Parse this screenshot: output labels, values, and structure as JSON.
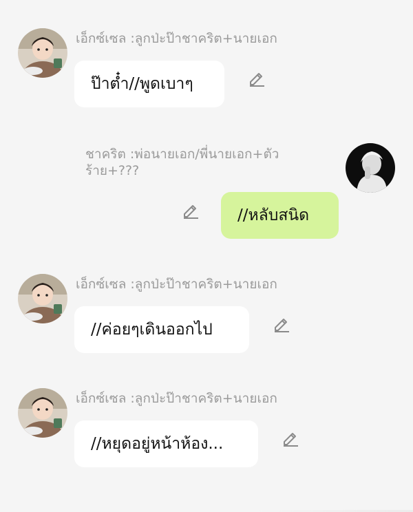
{
  "messages": [
    {
      "side": "left",
      "sender": "เอ็กซ์เซล :ลูกป่ะป๊าชาคริต+นายเอก",
      "text": "ป๊าต๋ำ//พูดเบาๆ",
      "avatar_icon": "baby-avatar-icon",
      "edit_icon": "pencil-icon"
    },
    {
      "side": "right",
      "sender": "ชาคริต :พ่อนายเอก/พี่นายเอก+ตัวร้าย+???",
      "text": "//หลับสนิด",
      "avatar_icon": "man-avatar-icon",
      "edit_icon": "pencil-icon"
    },
    {
      "side": "left",
      "sender": "เอ็กซ์เซล :ลูกป่ะป๊าชาคริต+นายเอก",
      "text": "//ค่อยๆเดินออกไป",
      "avatar_icon": "baby-avatar-icon",
      "edit_icon": "pencil-icon"
    },
    {
      "side": "left",
      "sender": "เอ็กซ์เซล :ลูกป่ะป๊าชาคริต+นายเอก",
      "text": "//หยุดอยู่หน้าห้อง...",
      "avatar_icon": "baby-avatar-icon",
      "edit_icon": "pencil-icon"
    }
  ],
  "colors": {
    "background": "#f5f5f5",
    "bubble_other": "#ffffff",
    "bubble_self": "#d6f49c",
    "sender_text": "#9a9a9a",
    "icon": "#8a8a8a"
  }
}
